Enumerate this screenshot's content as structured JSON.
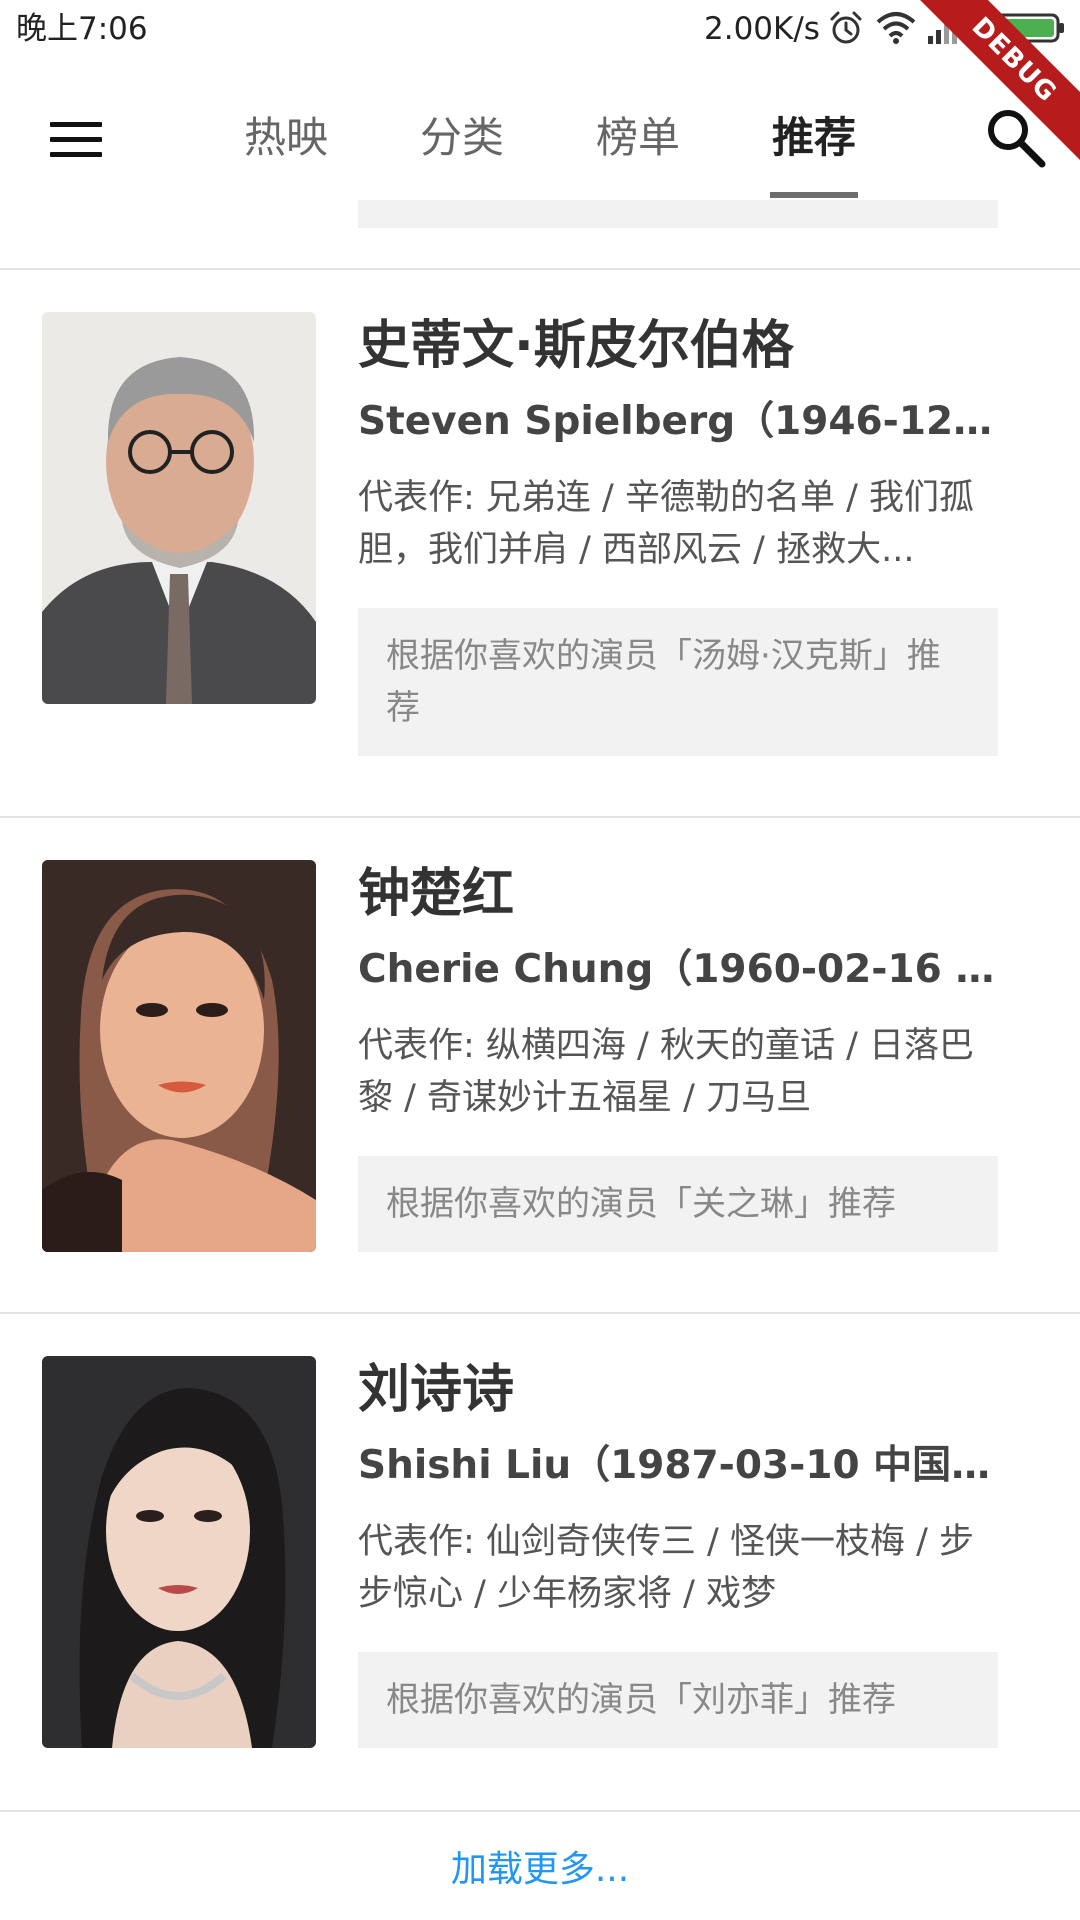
{
  "status_bar": {
    "time": "晚上7:06",
    "speed": "2.00K/s",
    "icons": [
      "alarm-icon",
      "wifi-icon",
      "signal-icon",
      "battery-charging-icon"
    ]
  },
  "debug_banner": "DEBUG",
  "app_bar": {
    "menu_icon": "hamburger-menu-icon",
    "search_icon": "search-icon",
    "tabs": [
      {
        "label": "热映",
        "active": false
      },
      {
        "label": "分类",
        "active": false
      },
      {
        "label": "榜单",
        "active": false
      },
      {
        "label": "推荐",
        "active": true
      }
    ]
  },
  "colors": {
    "accent_link": "#2196f3",
    "debug_red": "#b71c1c",
    "reason_bg": "#f2f2f2",
    "battery_green": "#4caf50"
  },
  "recommendations": [
    {
      "name_cn": "史蒂文·斯皮尔伯格",
      "name_en": "Steven Spielberg（1946-12-1...",
      "works": "代表作: 兄弟连 / 辛德勒的名单 / 我们孤胆，我们并肩 / 西部风云 / 拯救大...",
      "reason": "根据你喜欢的演员「汤姆·汉克斯」推荐",
      "photo": "actor-photo"
    },
    {
      "name_cn": "钟楚红",
      "name_en": "Cherie Chung（1960-02-16 中...",
      "works": "代表作: 纵横四海 / 秋天的童话 / 日落巴黎 / 奇谋妙计五福星 / 刀马旦",
      "reason": "根据你喜欢的演员「关之琳」推荐",
      "photo": "actor-photo"
    },
    {
      "name_cn": "刘诗诗",
      "name_en": "Shishi Liu（1987-03-10 中国,...",
      "works": "代表作: 仙剑奇侠传三 / 怪侠一枝梅 / 步步惊心 / 少年杨家将 / 戏梦",
      "reason": "根据你喜欢的演员「刘亦菲」推荐",
      "photo": "actor-photo"
    }
  ],
  "load_more": "加载更多..."
}
